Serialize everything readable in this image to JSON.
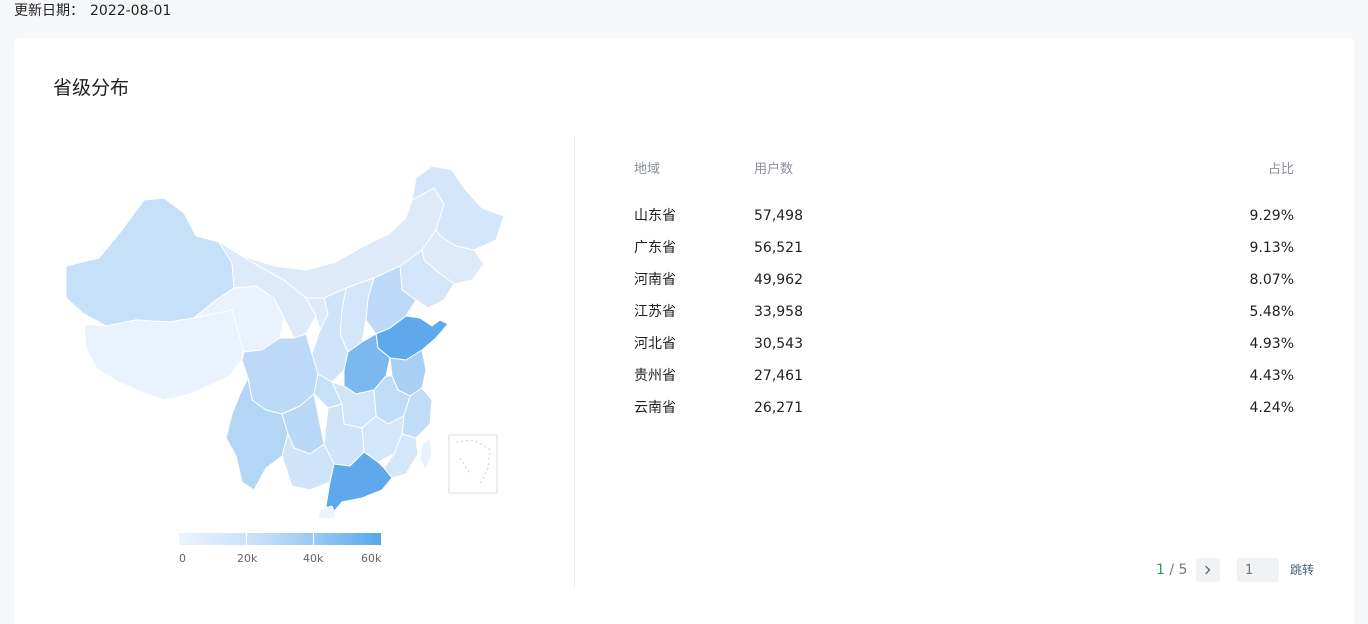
{
  "header": {
    "update_label": "更新日期：",
    "update_date": "2022-08-01"
  },
  "card": {
    "title": "省级分布"
  },
  "map": {
    "legend": {
      "ticks": [
        "0",
        "20k",
        "40k",
        "60k"
      ],
      "colors": {
        "min": "#eaf3fd",
        "mid": "#c6e0f9",
        "high": "#94c6f1",
        "max": "#56a7ec"
      }
    }
  },
  "table": {
    "headers": {
      "region": "地域",
      "users": "用户数",
      "ratio": "占比"
    },
    "rows": [
      {
        "region": "山东省",
        "users": "57,498",
        "ratio": "9.29%"
      },
      {
        "region": "广东省",
        "users": "56,521",
        "ratio": "9.13%"
      },
      {
        "region": "河南省",
        "users": "49,962",
        "ratio": "8.07%"
      },
      {
        "region": "江苏省",
        "users": "33,958",
        "ratio": "5.48%"
      },
      {
        "region": "河北省",
        "users": "30,543",
        "ratio": "4.93%"
      },
      {
        "region": "贵州省",
        "users": "27,461",
        "ratio": "4.43%"
      },
      {
        "region": "云南省",
        "users": "26,271",
        "ratio": "4.24%"
      }
    ]
  },
  "pagination": {
    "current": "1",
    "separator": "/",
    "total": "5",
    "next_icon": "chevron-right-icon",
    "jump_placeholder": "1",
    "jump_label": "跳转"
  }
}
